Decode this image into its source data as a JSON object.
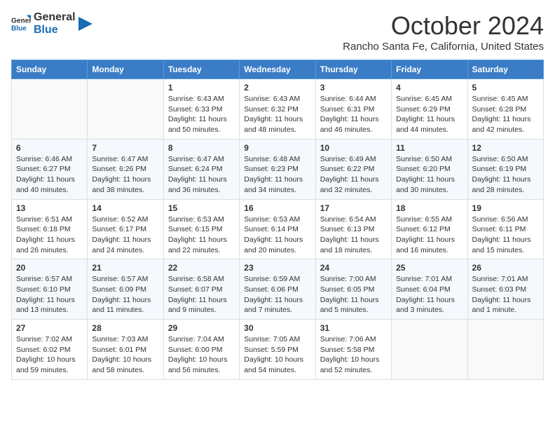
{
  "logo": {
    "line1": "General",
    "line2": "Blue"
  },
  "title": "October 2024",
  "location": "Rancho Santa Fe, California, United States",
  "days_header": [
    "Sunday",
    "Monday",
    "Tuesday",
    "Wednesday",
    "Thursday",
    "Friday",
    "Saturday"
  ],
  "weeks": [
    [
      {
        "day": "",
        "sunrise": "",
        "sunset": "",
        "daylight": ""
      },
      {
        "day": "",
        "sunrise": "",
        "sunset": "",
        "daylight": ""
      },
      {
        "day": "1",
        "sunrise": "Sunrise: 6:43 AM",
        "sunset": "Sunset: 6:33 PM",
        "daylight": "Daylight: 11 hours and 50 minutes."
      },
      {
        "day": "2",
        "sunrise": "Sunrise: 6:43 AM",
        "sunset": "Sunset: 6:32 PM",
        "daylight": "Daylight: 11 hours and 48 minutes."
      },
      {
        "day": "3",
        "sunrise": "Sunrise: 6:44 AM",
        "sunset": "Sunset: 6:31 PM",
        "daylight": "Daylight: 11 hours and 46 minutes."
      },
      {
        "day": "4",
        "sunrise": "Sunrise: 6:45 AM",
        "sunset": "Sunset: 6:29 PM",
        "daylight": "Daylight: 11 hours and 44 minutes."
      },
      {
        "day": "5",
        "sunrise": "Sunrise: 6:45 AM",
        "sunset": "Sunset: 6:28 PM",
        "daylight": "Daylight: 11 hours and 42 minutes."
      }
    ],
    [
      {
        "day": "6",
        "sunrise": "Sunrise: 6:46 AM",
        "sunset": "Sunset: 6:27 PM",
        "daylight": "Daylight: 11 hours and 40 minutes."
      },
      {
        "day": "7",
        "sunrise": "Sunrise: 6:47 AM",
        "sunset": "Sunset: 6:26 PM",
        "daylight": "Daylight: 11 hours and 38 minutes."
      },
      {
        "day": "8",
        "sunrise": "Sunrise: 6:47 AM",
        "sunset": "Sunset: 6:24 PM",
        "daylight": "Daylight: 11 hours and 36 minutes."
      },
      {
        "day": "9",
        "sunrise": "Sunrise: 6:48 AM",
        "sunset": "Sunset: 6:23 PM",
        "daylight": "Daylight: 11 hours and 34 minutes."
      },
      {
        "day": "10",
        "sunrise": "Sunrise: 6:49 AM",
        "sunset": "Sunset: 6:22 PM",
        "daylight": "Daylight: 11 hours and 32 minutes."
      },
      {
        "day": "11",
        "sunrise": "Sunrise: 6:50 AM",
        "sunset": "Sunset: 6:20 PM",
        "daylight": "Daylight: 11 hours and 30 minutes."
      },
      {
        "day": "12",
        "sunrise": "Sunrise: 6:50 AM",
        "sunset": "Sunset: 6:19 PM",
        "daylight": "Daylight: 11 hours and 28 minutes."
      }
    ],
    [
      {
        "day": "13",
        "sunrise": "Sunrise: 6:51 AM",
        "sunset": "Sunset: 6:18 PM",
        "daylight": "Daylight: 11 hours and 26 minutes."
      },
      {
        "day": "14",
        "sunrise": "Sunrise: 6:52 AM",
        "sunset": "Sunset: 6:17 PM",
        "daylight": "Daylight: 11 hours and 24 minutes."
      },
      {
        "day": "15",
        "sunrise": "Sunrise: 6:53 AM",
        "sunset": "Sunset: 6:15 PM",
        "daylight": "Daylight: 11 hours and 22 minutes."
      },
      {
        "day": "16",
        "sunrise": "Sunrise: 6:53 AM",
        "sunset": "Sunset: 6:14 PM",
        "daylight": "Daylight: 11 hours and 20 minutes."
      },
      {
        "day": "17",
        "sunrise": "Sunrise: 6:54 AM",
        "sunset": "Sunset: 6:13 PM",
        "daylight": "Daylight: 11 hours and 18 minutes."
      },
      {
        "day": "18",
        "sunrise": "Sunrise: 6:55 AM",
        "sunset": "Sunset: 6:12 PM",
        "daylight": "Daylight: 11 hours and 16 minutes."
      },
      {
        "day": "19",
        "sunrise": "Sunrise: 6:56 AM",
        "sunset": "Sunset: 6:11 PM",
        "daylight": "Daylight: 11 hours and 15 minutes."
      }
    ],
    [
      {
        "day": "20",
        "sunrise": "Sunrise: 6:57 AM",
        "sunset": "Sunset: 6:10 PM",
        "daylight": "Daylight: 11 hours and 13 minutes."
      },
      {
        "day": "21",
        "sunrise": "Sunrise: 6:57 AM",
        "sunset": "Sunset: 6:09 PM",
        "daylight": "Daylight: 11 hours and 11 minutes."
      },
      {
        "day": "22",
        "sunrise": "Sunrise: 6:58 AM",
        "sunset": "Sunset: 6:07 PM",
        "daylight": "Daylight: 11 hours and 9 minutes."
      },
      {
        "day": "23",
        "sunrise": "Sunrise: 6:59 AM",
        "sunset": "Sunset: 6:06 PM",
        "daylight": "Daylight: 11 hours and 7 minutes."
      },
      {
        "day": "24",
        "sunrise": "Sunrise: 7:00 AM",
        "sunset": "Sunset: 6:05 PM",
        "daylight": "Daylight: 11 hours and 5 minutes."
      },
      {
        "day": "25",
        "sunrise": "Sunrise: 7:01 AM",
        "sunset": "Sunset: 6:04 PM",
        "daylight": "Daylight: 11 hours and 3 minutes."
      },
      {
        "day": "26",
        "sunrise": "Sunrise: 7:01 AM",
        "sunset": "Sunset: 6:03 PM",
        "daylight": "Daylight: 11 hours and 1 minute."
      }
    ],
    [
      {
        "day": "27",
        "sunrise": "Sunrise: 7:02 AM",
        "sunset": "Sunset: 6:02 PM",
        "daylight": "Daylight: 10 hours and 59 minutes."
      },
      {
        "day": "28",
        "sunrise": "Sunrise: 7:03 AM",
        "sunset": "Sunset: 6:01 PM",
        "daylight": "Daylight: 10 hours and 58 minutes."
      },
      {
        "day": "29",
        "sunrise": "Sunrise: 7:04 AM",
        "sunset": "Sunset: 6:00 PM",
        "daylight": "Daylight: 10 hours and 56 minutes."
      },
      {
        "day": "30",
        "sunrise": "Sunrise: 7:05 AM",
        "sunset": "Sunset: 5:59 PM",
        "daylight": "Daylight: 10 hours and 54 minutes."
      },
      {
        "day": "31",
        "sunrise": "Sunrise: 7:06 AM",
        "sunset": "Sunset: 5:58 PM",
        "daylight": "Daylight: 10 hours and 52 minutes."
      },
      {
        "day": "",
        "sunrise": "",
        "sunset": "",
        "daylight": ""
      },
      {
        "day": "",
        "sunrise": "",
        "sunset": "",
        "daylight": ""
      }
    ]
  ]
}
